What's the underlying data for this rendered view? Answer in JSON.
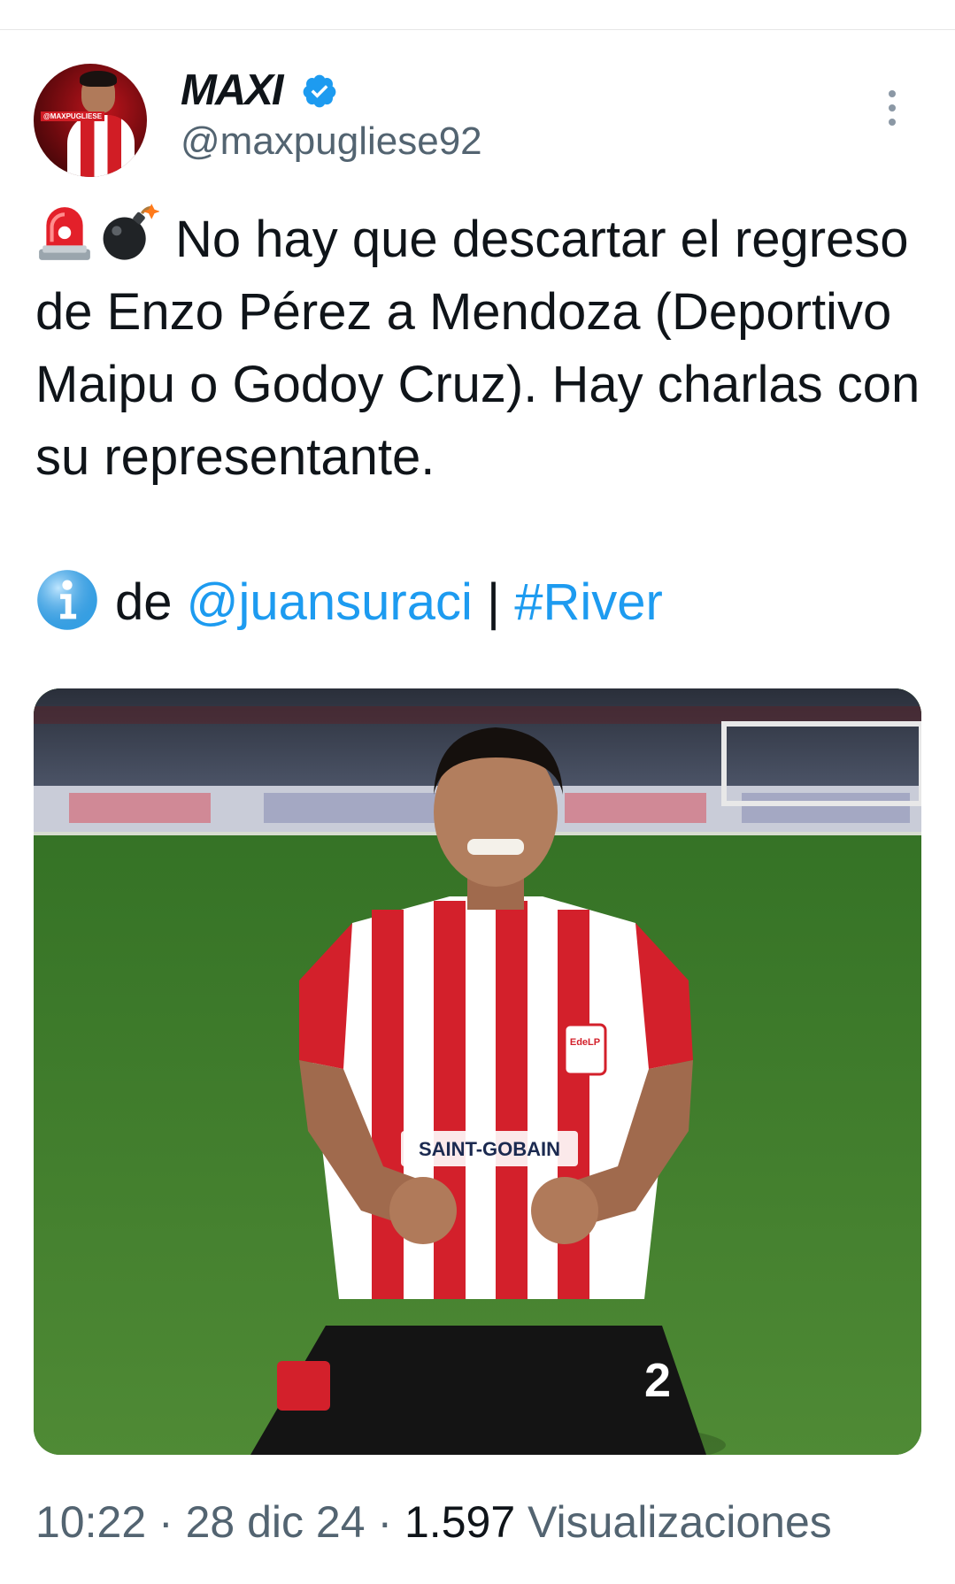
{
  "tweet": {
    "author_name": "MAXI",
    "verified": true,
    "handle": "@maxpugliese92",
    "avatar_tag": "@MAXPUGLIESE",
    "text": "No hay que descartar el regreso de Enzo Pérez a Mendoza (Deportivo Maipu o Godoy Cruz). Hay charlas con su representante.",
    "leading_emojis": [
      "rotating-light-icon",
      "bomb-icon"
    ],
    "source_prefix": "de",
    "source_mention": "@juansuraci",
    "separator": "|",
    "hashtag": "#River",
    "info_emoji": "information-icon",
    "media": {
      "jersey_sponsor": "SAINT-GOBAIN",
      "crest_text": "EdeLP",
      "shirt_number": "2"
    },
    "time": "10:22",
    "date": "28 dic 24",
    "views_count": "1.597",
    "views_label": "Visualizaciones",
    "dot": "·"
  },
  "colors": {
    "link": "#1d9bf0",
    "verified": "#1d9bf0",
    "secondary_text": "#536471",
    "primary_text": "#0f1419"
  }
}
